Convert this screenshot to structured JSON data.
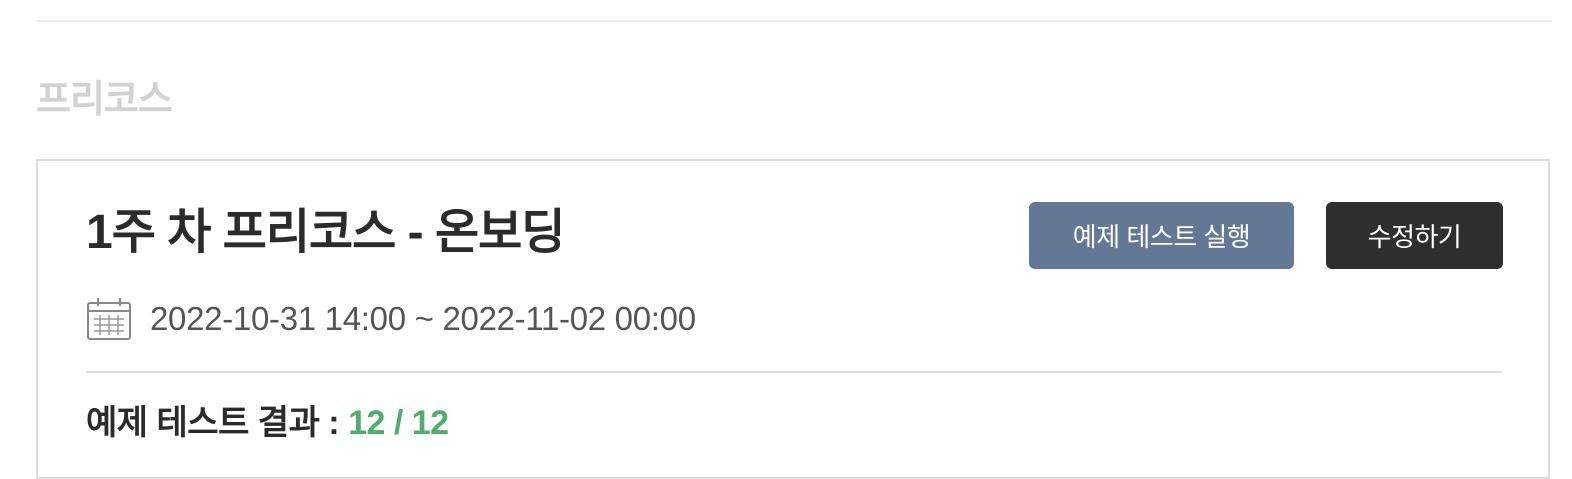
{
  "section": {
    "title": "프리코스"
  },
  "card": {
    "title": "1주 차 프리코스 - 온보딩",
    "date_range": "2022-10-31 14:00 ~ 2022-11-02 00:00",
    "buttons": {
      "run_tests_label": "예제 테스트 실행",
      "edit_label": "수정하기"
    },
    "result": {
      "label": "예제 테스트 결과 : ",
      "value": "12 / 12"
    },
    "icons": {
      "date": "calendar-icon"
    }
  },
  "colors": {
    "run_button": "#647895",
    "edit_button": "#2f2f2f",
    "result_value": "#4fae6b",
    "section_title": "#d2d2d2"
  }
}
